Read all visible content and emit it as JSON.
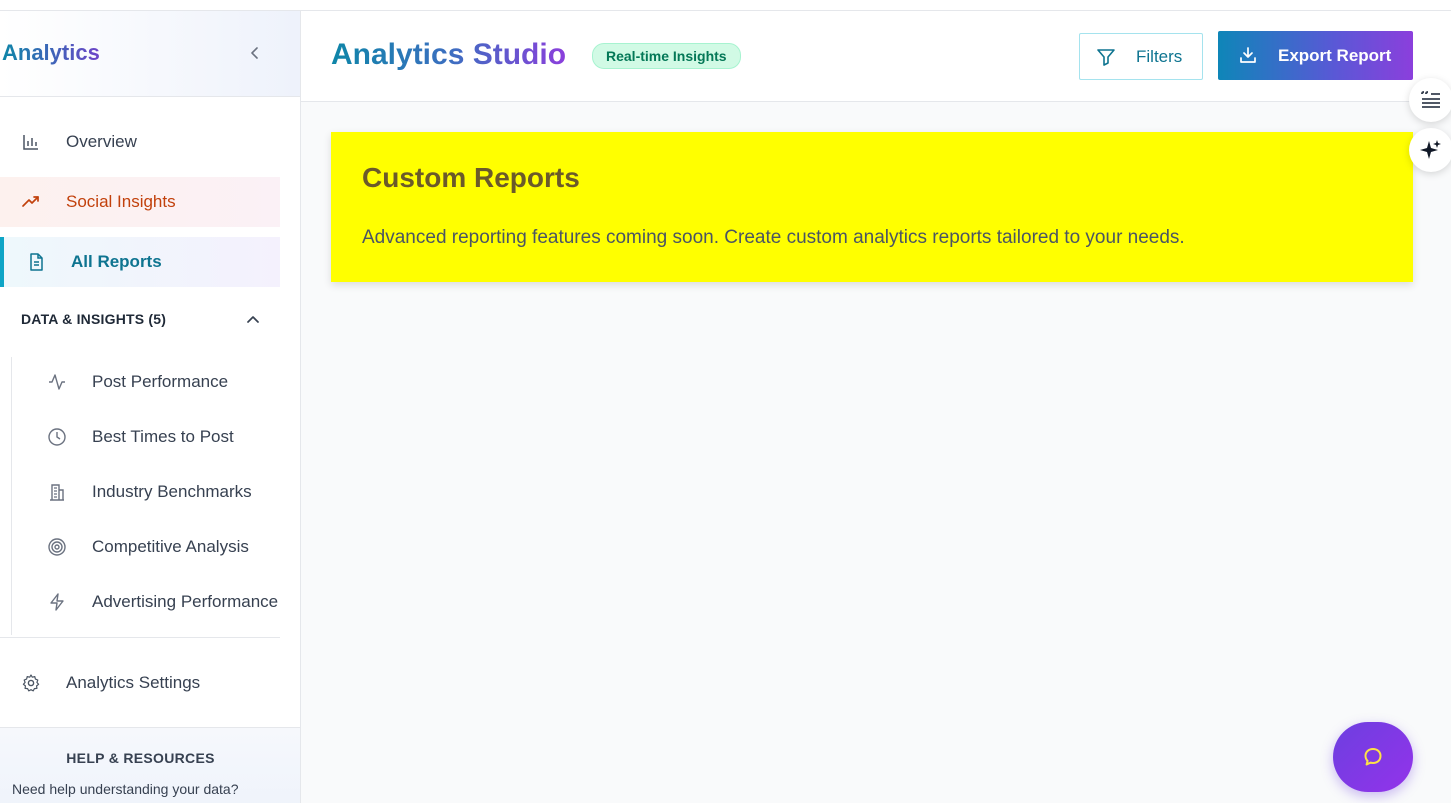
{
  "sidebar": {
    "title": "Analytics",
    "nav": {
      "overview": "Overview",
      "social_insights": "Social Insights",
      "all_reports": "All Reports"
    },
    "section": {
      "title": "DATA & INSIGHTS (5)",
      "items": [
        {
          "label": "Post Performance",
          "icon": "activity-icon"
        },
        {
          "label": "Best Times to Post",
          "icon": "clock-icon"
        },
        {
          "label": "Industry Benchmarks",
          "icon": "building-icon"
        },
        {
          "label": "Competitive Analysis",
          "icon": "target-icon"
        },
        {
          "label": "Advertising Performance",
          "icon": "lightning-icon"
        }
      ]
    },
    "settings": "Analytics Settings",
    "help": {
      "title": "HELP & RESOURCES",
      "text": "Need help understanding your data?"
    }
  },
  "header": {
    "title": "Analytics Studio",
    "badge": "Real-time Insights",
    "filters_label": "Filters",
    "export_label": "Export Report"
  },
  "card": {
    "title": "Custom Reports",
    "text": "Advanced reporting features coming soon. Create custom analytics reports tailored to your needs."
  },
  "colors": {
    "accent_teal": "#0e86a8",
    "accent_purple": "#8b3fdc",
    "card_bg": "#ffff00",
    "social_active": "#c2410c",
    "reports_active": "#0e7490",
    "badge_green": "#047857"
  }
}
